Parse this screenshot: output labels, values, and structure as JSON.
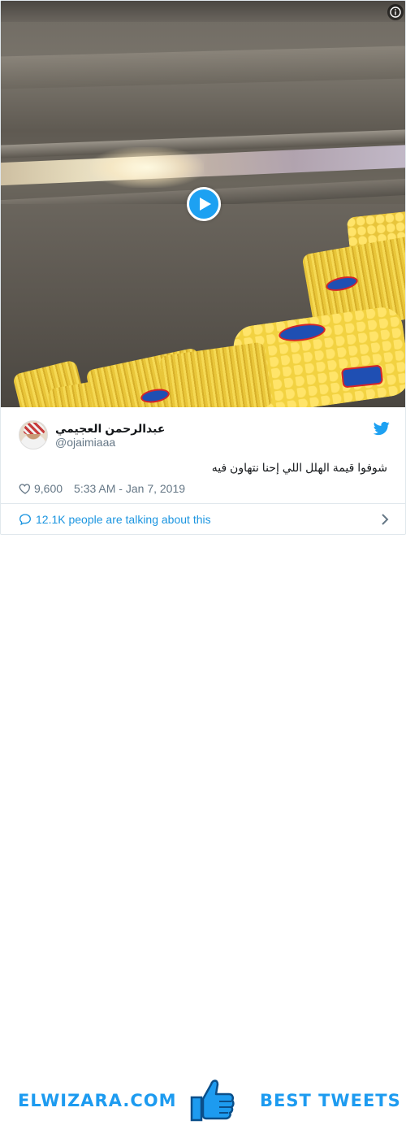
{
  "video": {
    "play_label": "Play video",
    "info_label": "i"
  },
  "tweet": {
    "author_name": "عبدالرحمن العجيمي",
    "author_handle": "@ojaimiaaa",
    "text": "شوفوا قيمة الهلل اللي إحنا نتهاون فيه",
    "likes": "9,600",
    "timestamp": "5:33 AM - Jan 7, 2019",
    "talking": "12.1K people are talking about this"
  },
  "footer": {
    "site": "ELWIZARA.COM",
    "tagline": "BEST TWEETS"
  },
  "colors": {
    "twitter_blue": "#1da1f2",
    "link_blue": "#1b95e0",
    "muted": "#657786",
    "brand_blue": "#1d9bf0"
  },
  "icons": {
    "play": "play-icon",
    "info": "info-icon",
    "bird": "twitter-bird-icon",
    "heart": "heart-icon",
    "comment": "comment-bubble-icon",
    "chevron": "chevron-right-icon",
    "thumb": "thumbs-up-icon"
  }
}
